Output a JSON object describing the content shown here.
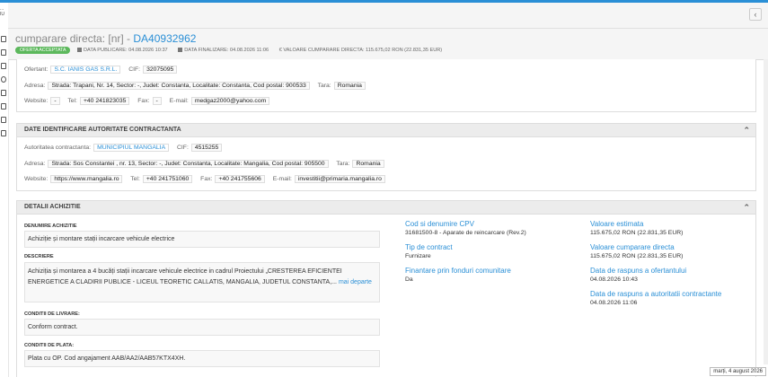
{
  "sidebar": {
    "menu_label": "...\nIU"
  },
  "header": {
    "back_icon": "chevron-left"
  },
  "title": {
    "prefix": "cumparare directa: [nr] - ",
    "code": "DA40932962",
    "status": "OFERTA ACCEPTATA",
    "publication": "DATA PUBLICARE: 04.08.2026 10:37",
    "finalization": "DATA FINALIZARE: 04.08.2026 11:06",
    "value": "€ VALOARE CUMPARARE DIRECTA: 115.675,02  RON (22.831,35  EUR)"
  },
  "ofertant": {
    "l_name": "Ofertant:",
    "name": "S.C. IANIS GAS S.R.L.",
    "l_cif": "CIF:",
    "cif": "32075095",
    "l_address": "Adresa:",
    "address": "Strada: Trapani, Nr. 14, Sector: -, Judet: Constanta, Localitate: Constanta, Cod postal: 900533",
    "l_country": "Tara:",
    "country": "Romania",
    "l_web": "Website:",
    "web": "-",
    "l_tel": "Tel:",
    "tel": "+40 241823035",
    "l_fax": "Fax:",
    "fax": "-",
    "l_email": "E-mail:",
    "email": "medgaz2000@yahoo.com"
  },
  "authority": {
    "heading": "DATE IDENTIFICARE AUTORITATE CONTRACTANTA",
    "l_name": "Autoritatea contractanta:",
    "name": "MUNICIPIUL MANGALIA",
    "l_cif": "CIF:",
    "cif": "4515255",
    "l_address": "Adresa:",
    "address": "Strada: Sos Constantei , nr. 13, Sector: -, Judet: Constanta, Localitate: Mangalia, Cod postal: 905500",
    "l_country": "Tara:",
    "country": "Romania",
    "l_web": "Website:",
    "web": "https://www.mangalia.ro",
    "l_tel": "Tel:",
    "tel": "+40 241751060",
    "l_fax": "Fax:",
    "fax": "+40 241755606",
    "l_email": "E-mail:",
    "email": "investitii@primaria.mangalia.ro"
  },
  "details": {
    "heading": "DETALII ACHIZITIE",
    "l_name": "DENUMIRE ACHIZITIE",
    "name": "Achiziție și montare stații incarcare vehicule electrice",
    "l_desc": "DESCRIERE",
    "desc": "Achiziția și montarea a 4 bucăți stații incarcare vehicule electrice in cadrul Proiectului „CRESTEREA EFICIENTEI ENERGETICE A CLADIRII PUBLICE - LICEUL TEORETIC CALLATIS, MANGALIA, JUDETUL CONSTANTA,...",
    "more": "mai departe",
    "l_delivery": "CONDITII DE LIVRARE:",
    "delivery": "Conform contract.",
    "l_payment": "CONDITII DE PLATA:",
    "payment": "Plata cu OP. Cod angajament AAB/AA2/AAB57KTX4XH.",
    "l_cpv": "Cod si denumire CPV",
    "cpv": "31681500-8 - Aparate de reincarcare (Rev.2)",
    "l_contract": "Tip de contract",
    "contract": "Furnizare",
    "l_funds": "Finantare prin fonduri comunitare",
    "funds": "Da",
    "l_est": "Valoare estimata",
    "est": "115.675,02  RON (22.831,35  EUR)",
    "l_buy": "Valoare cumparare directa",
    "buy": "115.675,02  RON (22.831,35  EUR)",
    "l_resp1": "Data de raspuns a ofertantului",
    "resp1": "04.08.2026 10:43",
    "l_resp2": "Data de raspuns a autoritatii contractante",
    "resp2": "04.08.2026 11:06"
  },
  "footer": {
    "date": "marți, 4 august 2026"
  }
}
